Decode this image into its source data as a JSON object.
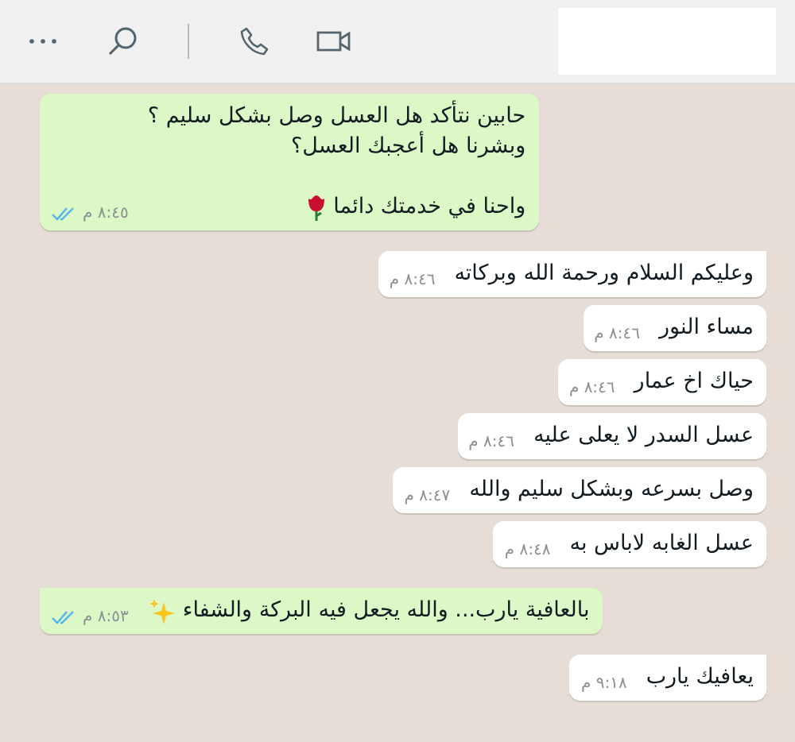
{
  "messages": [
    {
      "kind": "out",
      "paragraphs": [
        [
          "حابين نتأكد هل العسل وصل بشكل سليم ؟",
          "وبشرنا هل أعجبك العسل؟"
        ],
        [
          "واحنا في خدمتك دائما"
        ]
      ],
      "time": "٨:٤٥ م",
      "read": true,
      "tail": false
    },
    {
      "kind": "in",
      "paragraphs": [
        [
          "وعليكم السلام ورحمة الله وبركاته"
        ]
      ],
      "time": "٨:٤٦ م",
      "tail": true
    },
    {
      "kind": "in",
      "paragraphs": [
        [
          "مساء النور"
        ]
      ],
      "time": "٨:٤٦ م",
      "tail": false
    },
    {
      "kind": "in",
      "paragraphs": [
        [
          "حياك اخ عمار"
        ]
      ],
      "time": "٨:٤٦ م",
      "tail": false
    },
    {
      "kind": "in",
      "paragraphs": [
        [
          "عسل السدر لا يعلى عليه"
        ]
      ],
      "time": "٨:٤٦ م",
      "tail": false
    },
    {
      "kind": "in",
      "paragraphs": [
        [
          "وصل بسرعه وبشكل سليم والله"
        ]
      ],
      "time": "٨:٤٧ م",
      "tail": false
    },
    {
      "kind": "in",
      "paragraphs": [
        [
          "عسل الغابه لاباس به"
        ]
      ],
      "time": "٨:٤٨ م",
      "tail": false
    },
    {
      "kind": "out",
      "paragraphs": [
        [
          "بالعافية يارب... والله يجعل فيه البركة والشفاء"
        ]
      ],
      "time": "٨:٥٣ م",
      "read": true,
      "tail": true
    },
    {
      "kind": "in",
      "paragraphs": [
        [
          "يعافيك يارب"
        ]
      ],
      "time": "٩:١٨ م",
      "tail": true
    }
  ]
}
